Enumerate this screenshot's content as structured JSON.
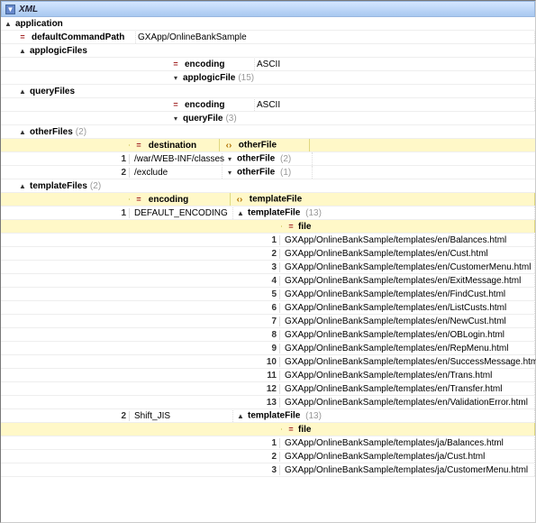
{
  "title": "XML",
  "root": {
    "name": "application",
    "defaultCommandPath": {
      "label": "defaultCommandPath",
      "value": "GXApp/OnlineBankSample"
    },
    "applogicFiles": {
      "label": "applogicFiles",
      "encoding": {
        "label": "encoding",
        "value": "ASCII"
      },
      "applogicFile": {
        "label": "applogicFile",
        "count": "(15)"
      }
    },
    "queryFiles": {
      "label": "queryFiles",
      "encoding": {
        "label": "encoding",
        "value": "ASCII"
      },
      "queryFile": {
        "label": "queryFile",
        "count": "(3)"
      }
    },
    "otherFiles": {
      "label": "otherFiles",
      "count": "(2)",
      "header": {
        "destination": "destination",
        "otherFile": "otherFile"
      },
      "rows": [
        {
          "n": "1",
          "destination": "/war/WEB-INF/classes",
          "otherFile": "otherFile",
          "count": "(2)"
        },
        {
          "n": "2",
          "destination": "/exclude",
          "otherFile": "otherFile",
          "count": "(1)"
        }
      ]
    },
    "templateFiles": {
      "label": "templateFiles",
      "count": "(2)",
      "header": {
        "encoding": "encoding",
        "templateFile": "templateFile"
      },
      "groups": [
        {
          "n": "1",
          "encoding": "DEFAULT_ENCODING",
          "templateFile": "templateFile",
          "count": "(13)",
          "fileHeader": "file",
          "files": [
            "GXApp/OnlineBankSample/templates/en/Balances.html",
            "GXApp/OnlineBankSample/templates/en/Cust.html",
            "GXApp/OnlineBankSample/templates/en/CustomerMenu.html",
            "GXApp/OnlineBankSample/templates/en/ExitMessage.html",
            "GXApp/OnlineBankSample/templates/en/FindCust.html",
            "GXApp/OnlineBankSample/templates/en/ListCusts.html",
            "GXApp/OnlineBankSample/templates/en/NewCust.html",
            "GXApp/OnlineBankSample/templates/en/OBLogin.html",
            "GXApp/OnlineBankSample/templates/en/RepMenu.html",
            "GXApp/OnlineBankSample/templates/en/SuccessMessage.html",
            "GXApp/OnlineBankSample/templates/en/Trans.html",
            "GXApp/OnlineBankSample/templates/en/Transfer.html",
            "GXApp/OnlineBankSample/templates/en/ValidationError.html"
          ]
        },
        {
          "n": "2",
          "encoding": "Shift_JIS",
          "templateFile": "templateFile",
          "count": "(13)",
          "fileHeader": "file",
          "files": [
            "GXApp/OnlineBankSample/templates/ja/Balances.html",
            "GXApp/OnlineBankSample/templates/ja/Cust.html",
            "GXApp/OnlineBankSample/templates/ja/CustomerMenu.html"
          ]
        }
      ]
    }
  }
}
